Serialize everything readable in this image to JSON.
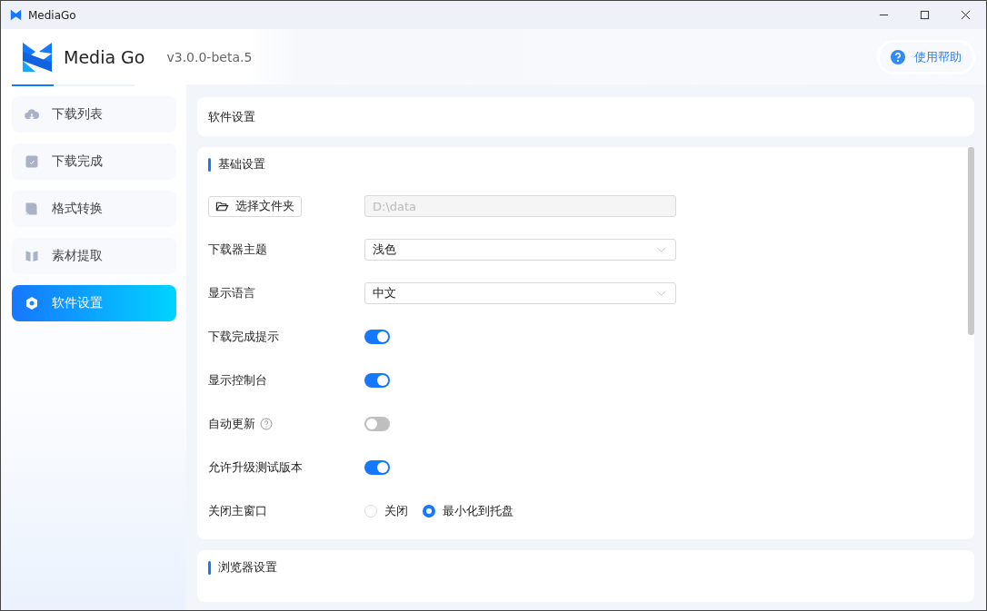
{
  "window": {
    "title": "MediaGo"
  },
  "header": {
    "app_name": "Media Go",
    "version": "v3.0.0-beta.5",
    "help_button": "使用帮助"
  },
  "sidebar": {
    "items": [
      {
        "label": "下载列表",
        "kind": "download",
        "selected": false
      },
      {
        "label": "下载完成",
        "kind": "done",
        "selected": false
      },
      {
        "label": "格式转换",
        "kind": "convert",
        "selected": false
      },
      {
        "label": "素材提取",
        "kind": "extract",
        "selected": false
      },
      {
        "label": "软件设置",
        "kind": "settings",
        "selected": true
      }
    ]
  },
  "page_title": "软件设置",
  "sections": [
    {
      "title": "基础设置",
      "rows": [
        {
          "kind": "folder",
          "button": "选择文件夹",
          "value": "D:\\data",
          "disabled": true
        },
        {
          "kind": "select",
          "label": "下载器主题",
          "value": "浅色"
        },
        {
          "kind": "select",
          "label": "显示语言",
          "value": "中文"
        },
        {
          "kind": "toggle",
          "label": "下载完成提示",
          "on": true
        },
        {
          "kind": "toggle",
          "label": "显示控制台",
          "on": true
        },
        {
          "kind": "toggle",
          "label": "自动更新",
          "on": false,
          "help": true
        },
        {
          "kind": "toggle",
          "label": "允许升级测试版本",
          "on": true
        },
        {
          "kind": "radio",
          "label": "关闭主窗口",
          "options": [
            {
              "label": "关闭",
              "selected": false
            },
            {
              "label": "最小化到托盘",
              "selected": true
            }
          ]
        }
      ]
    },
    {
      "title": "浏览器设置"
    }
  ]
}
